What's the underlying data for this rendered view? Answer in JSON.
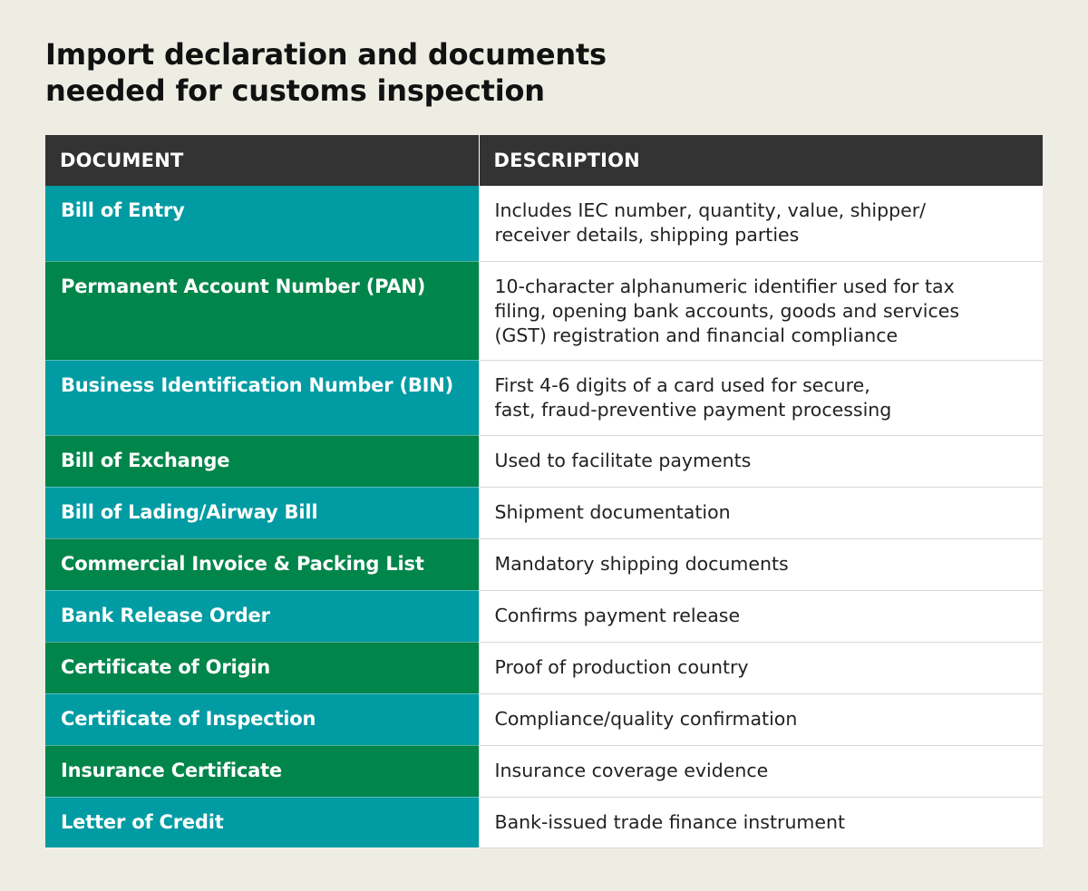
{
  "title": {
    "line1": "Import declaration and documents",
    "line2": "needed for customs inspection"
  },
  "table": {
    "headers": [
      "DOCUMENT",
      "DESCRIPTION"
    ],
    "rows": [
      {
        "document": "Bill of Entry",
        "description": [
          "Includes IEC number, quantity, value, shipper/",
          "receiver details, shipping parties"
        ]
      },
      {
        "document": "Permanent Account Number (PAN)",
        "description": [
          "10-character alphanumeric identifier used for tax",
          "filing, opening bank accounts, goods and services",
          "(GST) registration and financial compliance"
        ]
      },
      {
        "document": "Business Identification Number (BIN)",
        "description": [
          "First 4-6 digits of a card used for secure,",
          "fast, fraud-preventive payment processing"
        ]
      },
      {
        "document": "Bill of Exchange",
        "description": [
          "Used to facilitate payments"
        ]
      },
      {
        "document": "Bill of Lading/Airway Bill",
        "description": [
          "Shipment documentation"
        ]
      },
      {
        "document": "Commercial Invoice & Packing List",
        "description": [
          "Mandatory shipping documents"
        ]
      },
      {
        "document": "Bank Release Order",
        "description": [
          "Confirms payment release"
        ]
      },
      {
        "document": "Certificate of Origin",
        "description": [
          "Proof of production country"
        ]
      },
      {
        "document": "Certificate of Inspection",
        "description": [
          "Compliance/quality confirmation"
        ]
      },
      {
        "document": "Insurance Certificate",
        "description": [
          "Insurance coverage evidence"
        ]
      },
      {
        "document": "Letter of Credit",
        "description": [
          "Bank-issued trade finance instrument"
        ]
      }
    ]
  },
  "colors": {
    "background": "#eeede3",
    "header": "#333333",
    "teal": "#009ba3",
    "green": "#00854a"
  }
}
